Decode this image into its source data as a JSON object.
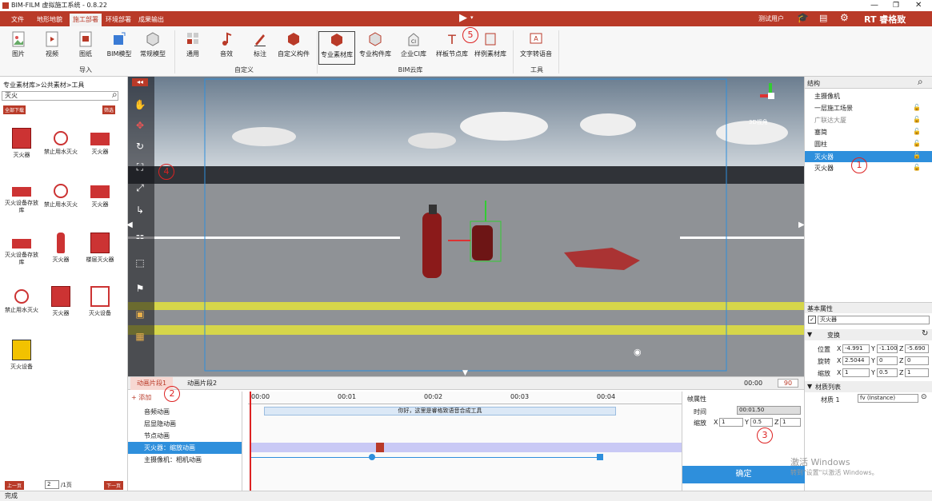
{
  "window": {
    "title": "BIM-FILM 虚拟施工系统 - 0.8.22"
  },
  "menu": {
    "tabs": [
      "文件",
      "地形地貌",
      "施工部署",
      "环境部署",
      "成果输出"
    ],
    "user": "测试用户",
    "brand": "RT 睿格致"
  },
  "ribbon": {
    "items": [
      "图片",
      "视频",
      "图纸",
      "BIM模型",
      "常规模型",
      "通用",
      "音效",
      "标注",
      "自定义构件",
      "专业素材库",
      "专业构件库",
      "企业CI库",
      "样板节点库",
      "样例素材库",
      "文字转语音"
    ],
    "groups": [
      "导入",
      "自定义",
      "BIM云库",
      "工具"
    ]
  },
  "left_panel": {
    "breadcrumb": "专业素材库>公共素材>工具",
    "search_value": "灭火",
    "download_all": "全部下载",
    "filter": "筛选",
    "assets": [
      "灭火器",
      "禁止用水灭火",
      "灭火器",
      "灭火设备存放库",
      "禁止用水灭火",
      "灭火器",
      "灭火设备存放库",
      "灭火器",
      "楼层灭火器",
      "禁止用水灭火",
      "灭火器",
      "灭火设备",
      "灭火设备"
    ],
    "prev": "上一页",
    "page": "2",
    "total": "/1页",
    "next": "下一页"
  },
  "viewport": {
    "view_label": "3D视角"
  },
  "right_panel": {
    "title": "结构",
    "tree": [
      "主摄像机",
      "一层施工场景",
      "广联达大厦",
      "塞简",
      "圆柱",
      "灭火器",
      "灭火器"
    ],
    "props_title": "基本属性",
    "name": "灭火器",
    "transform": "变换",
    "pos_label": "位置",
    "pos": [
      "-4.991",
      "-1.100",
      "-5.690"
    ],
    "rot_label": "旋转",
    "rot": [
      "2.5044",
      "0",
      "0"
    ],
    "scale_label": "缩放",
    "scale": [
      "1",
      "0.5",
      "1"
    ],
    "mat_title": "材质列表",
    "mat_label": "材质 1",
    "mat_value": "fv (Instance)"
  },
  "timeline": {
    "tabs": [
      "动画片段1",
      "动画片段2"
    ],
    "time": "00:00",
    "fps": "90",
    "add": "+ 添加",
    "tracks": [
      "音频动画",
      "层显隐动画",
      "节点动画",
      "灭火器：缩放动画",
      "主摄像机：相机动画"
    ],
    "ticks": [
      "00:00",
      "00:01",
      "00:02",
      "00:03",
      "00:04"
    ],
    "audio_text": "你好，这里是睿格致语音合成工具",
    "frame_title": "帧属性",
    "time_label": "时间",
    "time_value": "00:01.50",
    "scale_label": "缩放",
    "scale": [
      "1",
      "0.5",
      "1"
    ],
    "confirm": "确定"
  },
  "watermark": [
    "激活 Windows",
    "转到\"设置\"以激活 Windows。"
  ],
  "status": "完成",
  "annotations": [
    "1",
    "2",
    "3",
    "4",
    "5"
  ],
  "colors": {
    "brand": "#b93a28",
    "accent": "#2e8fdc"
  }
}
